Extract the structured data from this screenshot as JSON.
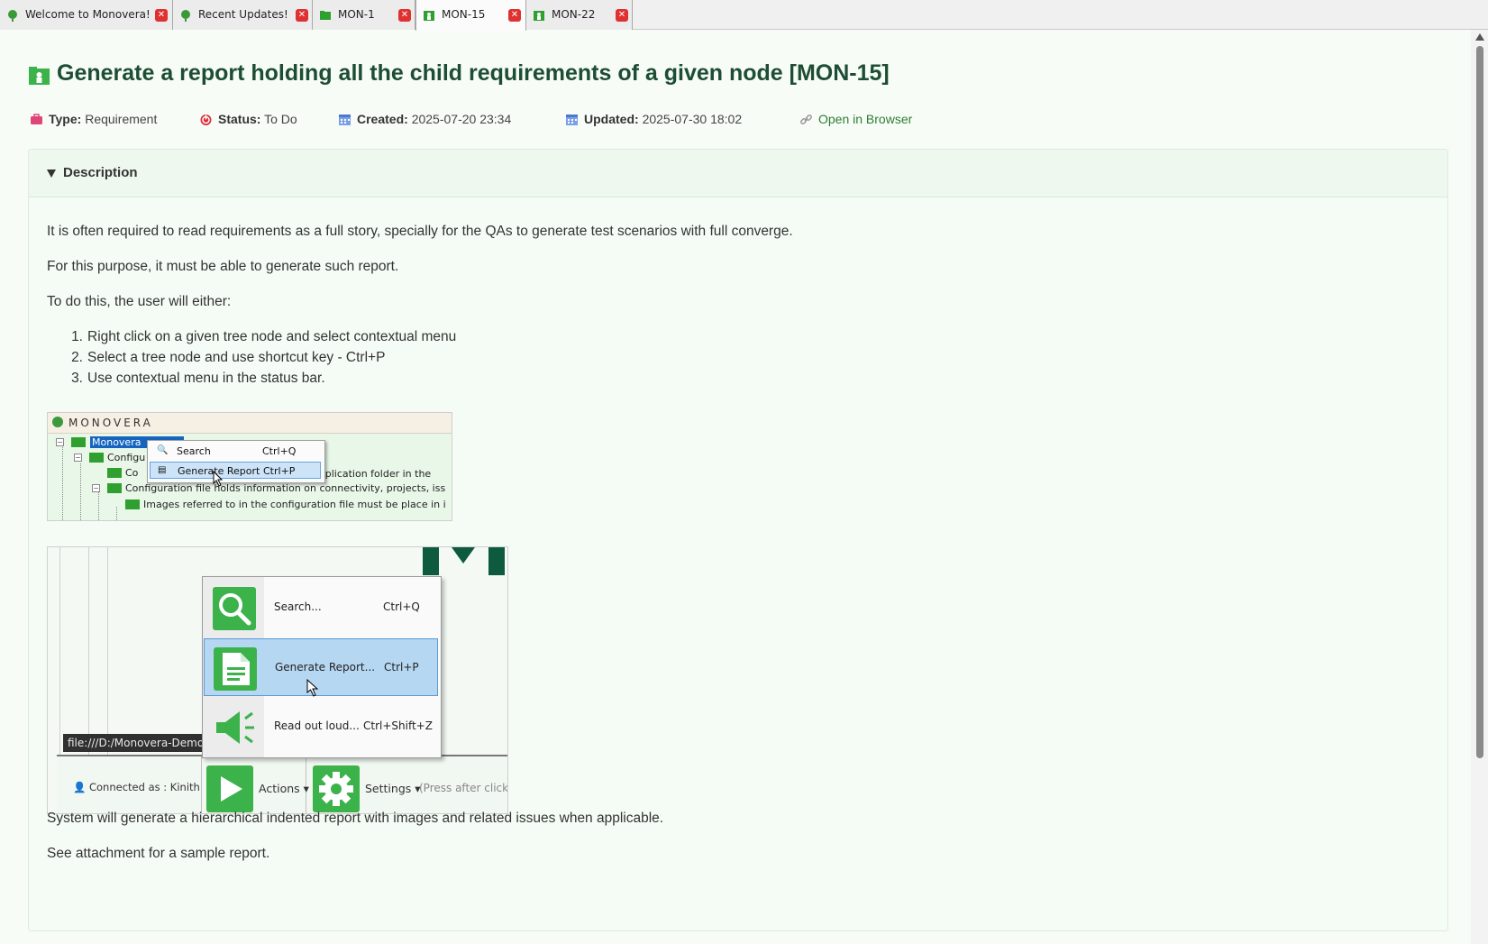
{
  "tabs": [
    {
      "label": "Welcome to Monovera!",
      "icon": "monovera-logo-icon",
      "active": false
    },
    {
      "label": "Recent Updates!",
      "icon": "monovera-logo-icon",
      "active": false
    },
    {
      "label": "MON-1",
      "icon": "folder-icon",
      "active": false
    },
    {
      "label": "MON-15",
      "icon": "requirement-icon",
      "active": true
    },
    {
      "label": "MON-22",
      "icon": "requirement-icon",
      "active": false
    }
  ],
  "issue": {
    "title": "Generate a report holding all the child requirements of a given node [MON-15]",
    "type_label": "Type:",
    "type_value": "Requirement",
    "status_label": "Status:",
    "status_value": "To Do",
    "created_label": "Created:",
    "created_value": "2025-07-20 23:34",
    "updated_label": "Updated:",
    "updated_value": "2025-07-30 18:02",
    "open_link": "Open in Browser"
  },
  "description": {
    "heading": "Description",
    "para1": "It is often required to read requirements as a full story, specially for the QAs to generate test scenarios with full converge.",
    "para2": "For this purpose, it must be able to generate such report.",
    "para3": "To do this, the user will either:",
    "steps": [
      {
        "num": "1.",
        "text": "Right click on a given tree node and select contextual menu"
      },
      {
        "num": "2.",
        "text": "Select a tree node and use shortcut key - Ctrl+P"
      },
      {
        "num": "3.",
        "text": "Use contextual menu in the status bar."
      }
    ],
    "para4": "System will generate a hierarchical indented report with images and related issues when applicable.",
    "para5": "See attachment for a sample report."
  },
  "screenshot1": {
    "brand": "MONOVERA",
    "tree": {
      "root": "Monovera",
      "node_config": "Configu",
      "node_con": "Co",
      "node_tail": "application folder in the",
      "node_config_file": "Configuration file holds information on connectivity, projects, iss",
      "node_images": "Images referred to in the configuration file must be place in i"
    },
    "menu": [
      {
        "label": "Search",
        "shortcut": "Ctrl+Q"
      },
      {
        "label": "Generate Report",
        "shortcut": "Ctrl+P"
      }
    ]
  },
  "screenshot2": {
    "url_tip": "file:///D:/Monovera-Demo/te",
    "menu": [
      {
        "label": "Search...",
        "shortcut": "Ctrl+Q",
        "icon": "search-icon"
      },
      {
        "label": "Generate Report...",
        "shortcut": "Ctrl+P",
        "icon": "document-icon"
      },
      {
        "label": "Read out loud...",
        "shortcut": "Ctrl+Shift+Z",
        "icon": "megaphone-icon"
      }
    ],
    "status": {
      "connected": "Connected as : Kinith",
      "actions": "Actions",
      "settings": "Settings",
      "hint": "(Press after clicking"
    }
  },
  "colors": {
    "title": "#1d4d33",
    "accent_green": "#3cb24a",
    "close_red": "#e03131",
    "selection_blue": "#b6d7f2"
  }
}
